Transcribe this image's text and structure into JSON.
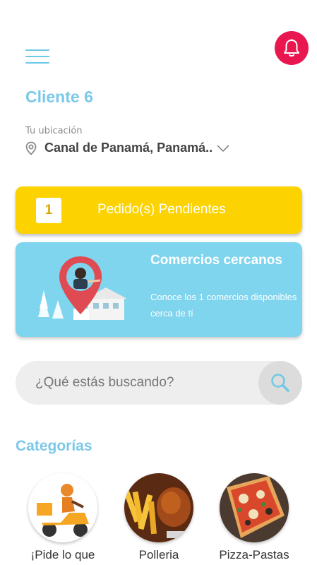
{
  "header": {
    "menu_icon": "hamburger-menu-icon",
    "notification_icon": "bell-icon",
    "accent_color": "#7cc8e8",
    "bell_color": "#e8174f"
  },
  "client": {
    "name": "Cliente 6"
  },
  "location": {
    "label": "Tu ubicación",
    "value": "Canal de Panamá, Panamá.."
  },
  "pending": {
    "count": "1",
    "label": "Pedido(s) Pendientes",
    "color": "#fcd300"
  },
  "nearby": {
    "title": "Comercios cercanos",
    "description": "Conoce los 1 comercios disponibles cerca de tí",
    "color": "#7fd4ee"
  },
  "search": {
    "placeholder": "¿Qué estás buscando?",
    "icon": "search-icon"
  },
  "categories": {
    "heading": "Categorías",
    "items": [
      {
        "label": "¡Pide lo que"
      },
      {
        "label": "Polleria"
      },
      {
        "label": "Pizza-Pastas"
      }
    ]
  }
}
